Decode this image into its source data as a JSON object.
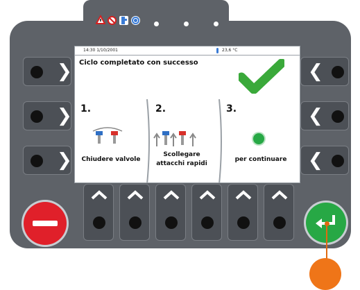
{
  "status_bar": {
    "datetime": "14:30 1/10/2001",
    "temperature": "23,6 °C"
  },
  "screen": {
    "message": "Ciclo completato con successo",
    "steps": [
      {
        "number": "1.",
        "label": "Chiudere valvole"
      },
      {
        "number": "2.",
        "label_line1": "Scollegare",
        "label_line2": "attacchi rapidi"
      },
      {
        "number": "3.",
        "label": "per continuare"
      }
    ]
  },
  "colors": {
    "check": "#3aa93a",
    "stop": "#e0202a",
    "enter": "#27a845",
    "callout": "#ef7518",
    "valve_red": "#d8302a",
    "valve_blue": "#2f6fc4"
  },
  "icons": {
    "status_leds": [
      "warning-icon",
      "no-entry-icon",
      "hose-icon",
      "gauge-icon",
      "led-icon",
      "led-icon",
      "led-icon"
    ],
    "success": "checkmark-icon",
    "stop": "minus-icon",
    "enter": "enter-icon"
  }
}
